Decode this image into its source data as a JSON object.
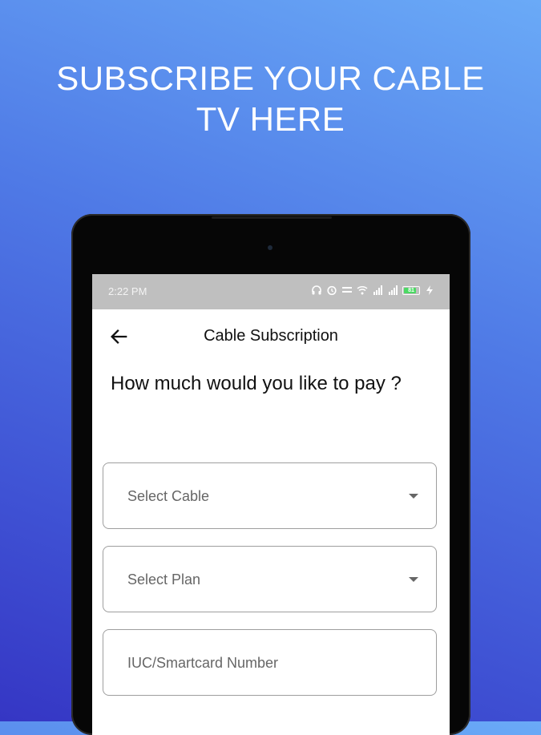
{
  "headline": {
    "line1": "SUBSCRIBE YOUR CABLE",
    "line2": "TV HERE"
  },
  "statusbar": {
    "time": "2:22 PM",
    "battery_level": "81",
    "icons": [
      "headphones-icon",
      "alarm-icon",
      "data-speed-icon",
      "wifi-icon",
      "signal-4g-icon",
      "signal-4g-icon",
      "battery-icon",
      "charging-icon"
    ]
  },
  "appbar": {
    "title": "Cable Subscription",
    "back_icon": "arrow-left-icon"
  },
  "form": {
    "question": "How much would you like to pay ?",
    "select_cable_placeholder": "Select Cable",
    "select_plan_placeholder": "Select Plan",
    "iuc_placeholder": "IUC/Smartcard Number"
  },
  "colors": {
    "gradient_top": "#6aaaf7",
    "gradient_bottom": "#3536c4",
    "statusbar": "#bfbfbf",
    "battery_fill": "#4cd964"
  }
}
